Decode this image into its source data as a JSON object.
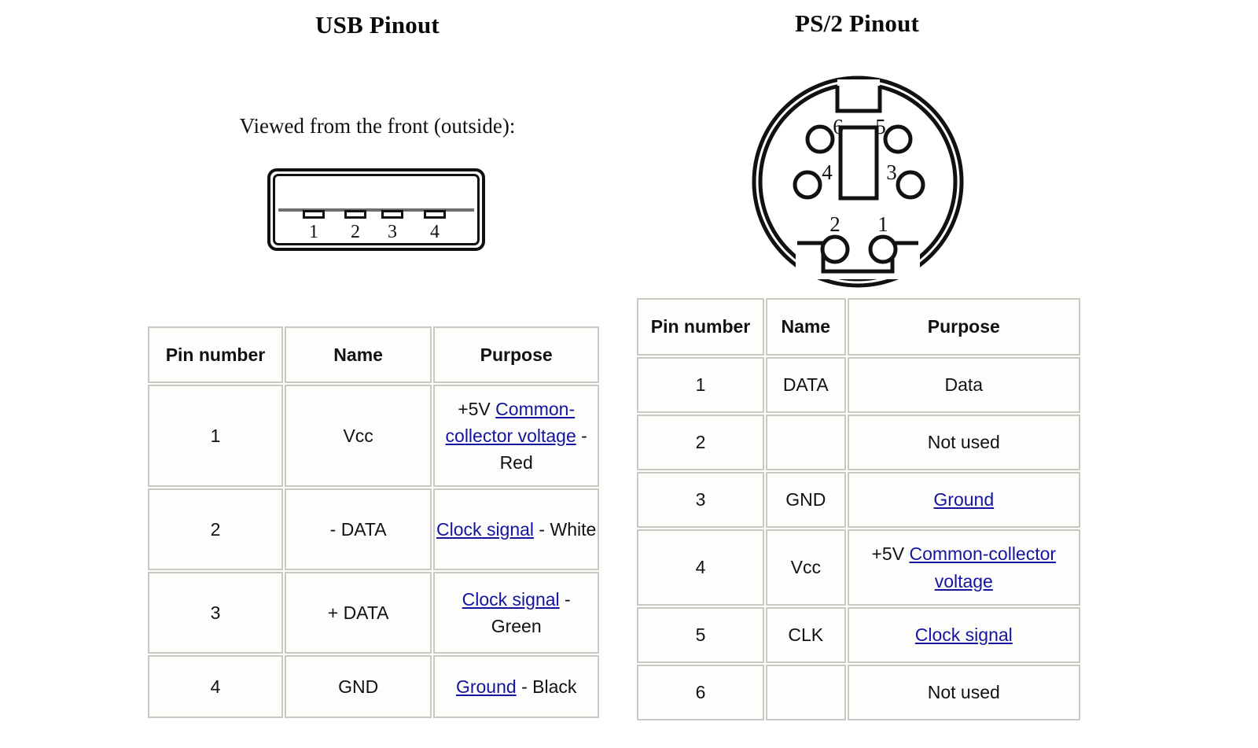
{
  "usb": {
    "title": "USB Pinout",
    "view_note": "Viewed from the front (outside):",
    "connector": {
      "name": "usb-type-a-connector",
      "pins": [
        {
          "number": "1"
        },
        {
          "number": "2"
        },
        {
          "number": "3"
        },
        {
          "number": "4"
        }
      ]
    },
    "table": {
      "headers": [
        "Pin number",
        "Name",
        "Purpose"
      ],
      "rows": [
        {
          "pin": "1",
          "name": "Vcc",
          "purpose_parts": [
            {
              "text": "+5V ",
              "link": false
            },
            {
              "text": "Common-collector voltage",
              "link": true
            },
            {
              "text": " - Red",
              "link": false
            }
          ]
        },
        {
          "pin": "2",
          "name": "- DATA",
          "purpose_parts": [
            {
              "text": "Clock signal",
              "link": true
            },
            {
              "text": " - White",
              "link": false
            }
          ]
        },
        {
          "pin": "3",
          "name": "+  DATA",
          "purpose_parts": [
            {
              "text": "Clock signal",
              "link": true
            },
            {
              "text": " - Green",
              "link": false
            }
          ]
        },
        {
          "pin": "4",
          "name": "GND",
          "purpose_parts": [
            {
              "text": "Ground",
              "link": true
            },
            {
              "text": " - Black",
              "link": false
            }
          ]
        }
      ]
    }
  },
  "ps2": {
    "title": "PS/2 Pinout",
    "connector": {
      "name": "ps2-mini-din-6-connector",
      "pins": [
        {
          "number": "1"
        },
        {
          "number": "2"
        },
        {
          "number": "3"
        },
        {
          "number": "4"
        },
        {
          "number": "5"
        },
        {
          "number": "6"
        }
      ]
    },
    "table": {
      "headers": [
        "Pin number",
        "Name",
        "Purpose"
      ],
      "rows": [
        {
          "pin": "1",
          "name": "DATA",
          "purpose_parts": [
            {
              "text": "Data",
              "link": false
            }
          ]
        },
        {
          "pin": "2",
          "name": "",
          "purpose_parts": [
            {
              "text": "Not used",
              "link": false
            }
          ]
        },
        {
          "pin": "3",
          "name": "GND",
          "purpose_parts": [
            {
              "text": "Ground",
              "link": true
            }
          ]
        },
        {
          "pin": "4",
          "name": "Vcc",
          "purpose_parts": [
            {
              "text": "+5V ",
              "link": false
            },
            {
              "text": "Common-collector voltage",
              "link": true
            }
          ]
        },
        {
          "pin": "5",
          "name": "CLK",
          "purpose_parts": [
            {
              "text": "Clock signal",
              "link": true
            }
          ]
        },
        {
          "pin": "6",
          "name": "",
          "purpose_parts": [
            {
              "text": "Not used",
              "link": false
            }
          ]
        }
      ]
    }
  },
  "colors": {
    "link": "#1414a0",
    "table_border": "#c9c9c1",
    "ink": "#111111",
    "page_background": "#ffffff"
  }
}
